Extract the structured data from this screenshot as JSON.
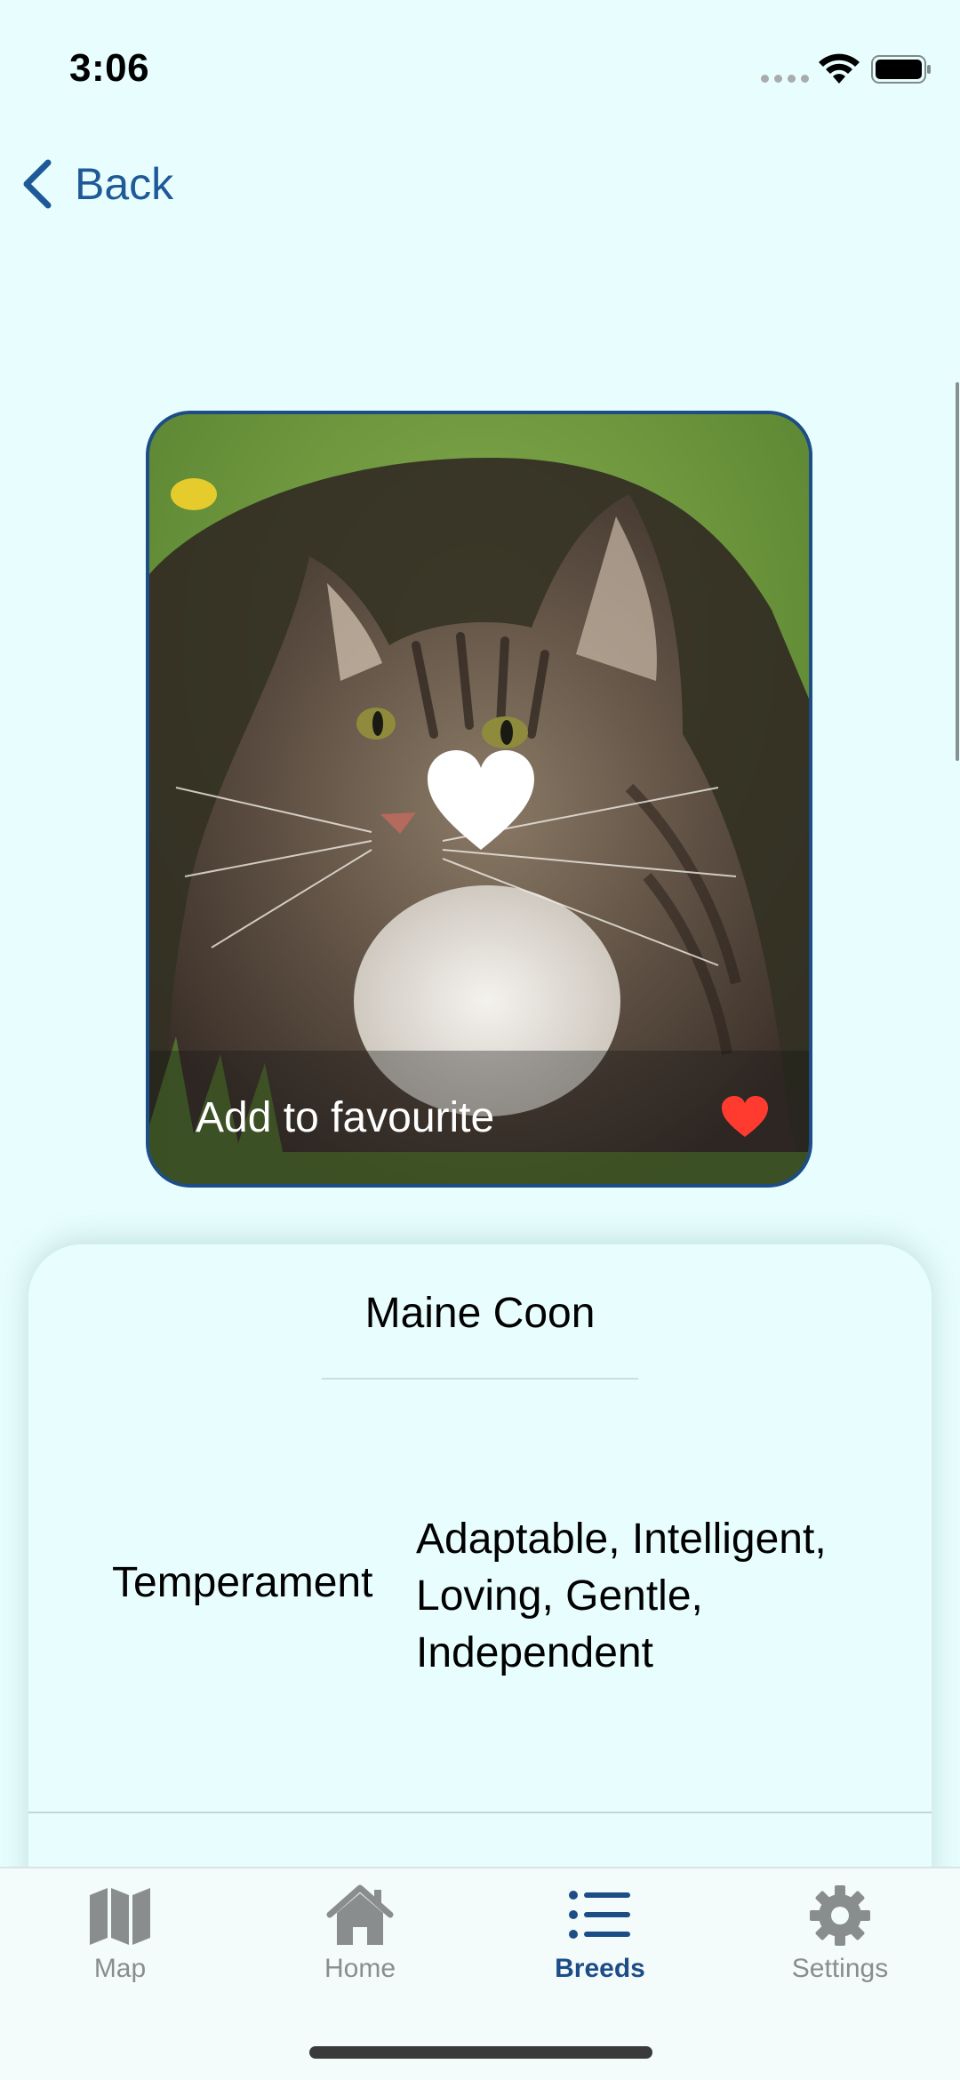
{
  "status_bar": {
    "time": "3:06"
  },
  "nav": {
    "back_label": "Back"
  },
  "photo_card": {
    "favourite_label": "Add to favourite",
    "heart_color": "#ff3b30"
  },
  "breed": {
    "name": "Maine Coon",
    "attributes": [
      {
        "label": "Temperament",
        "value": "Adaptable, Intelligent, Loving, Gentle, Independent"
      }
    ]
  },
  "tabs": [
    {
      "label": "Map",
      "icon": "map-icon",
      "active": false
    },
    {
      "label": "Home",
      "icon": "home-icon",
      "active": false
    },
    {
      "label": "Breeds",
      "icon": "list-icon",
      "active": true
    },
    {
      "label": "Settings",
      "icon": "gear-icon",
      "active": false
    }
  ],
  "colors": {
    "background": "#e8fefe",
    "accent": "#1d4d86",
    "inactive_tab": "#8a8d8e"
  }
}
